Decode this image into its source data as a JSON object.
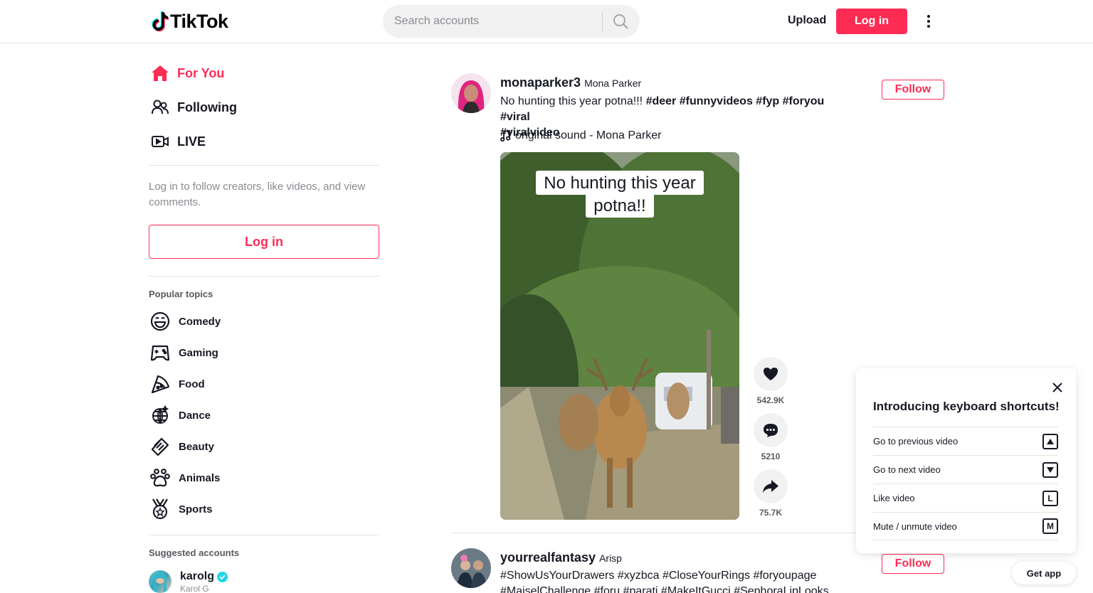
{
  "header": {
    "logo_text": "TikTok",
    "search_placeholder": "Search accounts",
    "upload_label": "Upload",
    "login_label": "Log in"
  },
  "sidebar": {
    "nav": [
      {
        "label": "For You",
        "icon": "home-icon",
        "active": true
      },
      {
        "label": "Following",
        "icon": "people-icon"
      },
      {
        "label": "LIVE",
        "icon": "live-icon"
      }
    ],
    "login_hint": "Log in to follow creators, like videos, and view comments.",
    "login_button": "Log in",
    "popular_topics_title": "Popular topics",
    "topics": [
      {
        "label": "Comedy",
        "icon": "smile-icon"
      },
      {
        "label": "Gaming",
        "icon": "gamepad-icon"
      },
      {
        "label": "Food",
        "icon": "pizza-icon"
      },
      {
        "label": "Dance",
        "icon": "disco-ball-icon"
      },
      {
        "label": "Beauty",
        "icon": "comb-icon"
      },
      {
        "label": "Animals",
        "icon": "paw-icon"
      },
      {
        "label": "Sports",
        "icon": "medal-icon"
      }
    ],
    "suggested_title": "Suggested accounts",
    "suggested": [
      {
        "username": "karolg",
        "nickname": "Karol G",
        "verified": true
      }
    ]
  },
  "feed": {
    "posts": [
      {
        "username": "monaparker3",
        "nickname": "Mona Parker",
        "caption_text": "No hunting this year potna!!! ",
        "hashtags_line1": "#deer #funnyvideos #fyp #foryou #viral",
        "hashtags_line2": "#viralvideo",
        "sound": "original sound - Mona Parker",
        "follow_label": "Follow",
        "video_overlay_line1": "No hunting this year",
        "video_overlay_line2": "potna!!",
        "likes": "542.9K",
        "comments": "5210",
        "shares": "75.7K"
      },
      {
        "username": "yourrealfantasy",
        "nickname": "Arisp",
        "hashtags_line1": "#ShowUsYourDrawers #xyzbca #CloseYourRings #foryoupage",
        "hashtags_line2": "#MaiselChallenge #foru #parati #MakeItGucci #SephoraLipLooks",
        "follow_label": "Follow"
      }
    ]
  },
  "shortcuts": {
    "title": "Introducing keyboard shortcuts!",
    "items": [
      {
        "label": "Go to previous video",
        "key": "▲"
      },
      {
        "label": "Go to next video",
        "key": "▼"
      },
      {
        "label": "Like video",
        "key": "L"
      },
      {
        "label": "Mute / unmute video",
        "key": "M"
      }
    ]
  },
  "get_app_label": "Get app",
  "colors": {
    "accent": "#fe2c55",
    "text": "#161823",
    "muted": "#8a8b91"
  }
}
